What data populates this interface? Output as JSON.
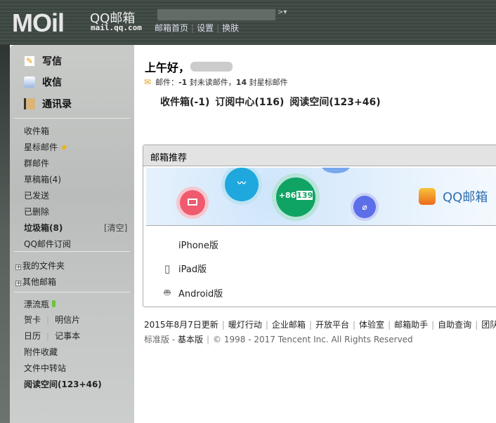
{
  "header": {
    "logo": "MOil",
    "brand": "QQ邮箱",
    "url": "mail.qq.com",
    "nav": [
      "邮箱首页",
      "设置",
      "换肤"
    ]
  },
  "sidebar": {
    "main": [
      {
        "label": "写信",
        "icon": "pencil-icon"
      },
      {
        "label": "收信",
        "icon": "inbox-icon"
      },
      {
        "label": "通讯录",
        "icon": "contacts-icon"
      }
    ],
    "folders": [
      "收件箱",
      "星标邮件",
      "群邮件",
      "草稿箱(4)",
      "已发送",
      "已删除"
    ],
    "trash": {
      "label": "垃圾箱(8)",
      "action": "[清空]"
    },
    "subscription": "QQ邮件订阅",
    "expandable": [
      "我的文件夹",
      "其他邮箱"
    ],
    "bottle": "漂流瓶",
    "pairs": [
      [
        "贺卡",
        "明信片"
      ],
      [
        "日历",
        "记事本"
      ]
    ],
    "extras": [
      "附件收藏",
      "文件中转站"
    ],
    "reading": "阅读空间(123+46)"
  },
  "main": {
    "greeting": "上午好，",
    "mail_prefix": "邮件：",
    "unread": "-1",
    "unread_suffix": " 封未读邮件，",
    "starred": "14",
    "starred_suffix": " 封星标邮件",
    "quick": [
      "收件箱(-1)",
      "订阅中心(116)",
      "阅读空间(123+46)"
    ],
    "box_title": "邮箱推荐",
    "banner": {
      "phone_prefix": "+86",
      "phone_num": "139",
      "brand": "QQ邮箱"
    },
    "apps": [
      {
        "label": "iPhone版",
        "icon": "apple-icon"
      },
      {
        "label": "iPad版",
        "icon": "ipad-icon"
      },
      {
        "label": "Android版",
        "icon": "android-icon"
      }
    ]
  },
  "footer": {
    "links": [
      "2015年8月7日更新",
      "暖灯行动",
      "企业邮箱",
      "开放平台",
      "体验室",
      "邮箱助手",
      "自助查询",
      "团队"
    ],
    "versions": [
      "标准版",
      "基本版"
    ],
    "copyright": "© 1998 - 2017 Tencent Inc. All Rights Reserved"
  }
}
